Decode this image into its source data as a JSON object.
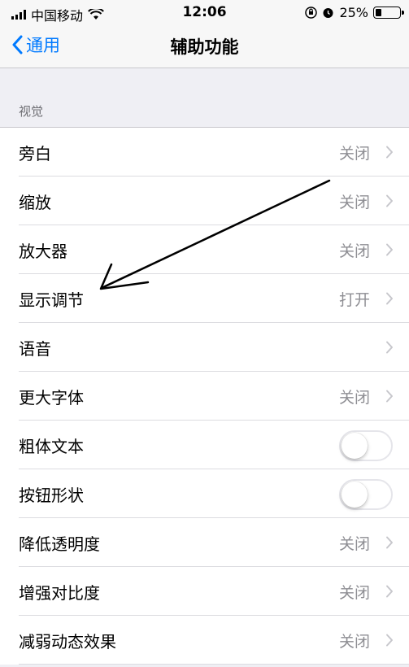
{
  "status_bar": {
    "carrier": "中国移动",
    "time": "12:06",
    "battery": "25%",
    "battery_level": 0.25,
    "icons": [
      "signal-icon",
      "wifi-icon",
      "orientation-lock-icon",
      "alarm-icon",
      "battery-icon"
    ]
  },
  "nav": {
    "back_label": "通用",
    "title": "辅助功能"
  },
  "section": {
    "header": "视觉"
  },
  "rows": [
    {
      "label": "旁白",
      "value": "关闭",
      "type": "detail"
    },
    {
      "label": "缩放",
      "value": "关闭",
      "type": "detail"
    },
    {
      "label": "放大器",
      "value": "关闭",
      "type": "detail"
    },
    {
      "label": "显示调节",
      "value": "打开",
      "type": "detail"
    },
    {
      "label": "语音",
      "value": "",
      "type": "detail"
    },
    {
      "label": "更大字体",
      "value": "关闭",
      "type": "detail"
    },
    {
      "label": "粗体文本",
      "value": "",
      "type": "toggle",
      "on": false
    },
    {
      "label": "按钮形状",
      "value": "",
      "type": "toggle",
      "on": false
    },
    {
      "label": "降低透明度",
      "value": "关闭",
      "type": "detail"
    },
    {
      "label": "增强对比度",
      "value": "关闭",
      "type": "detail"
    },
    {
      "label": "减弱动态效果",
      "value": "关闭",
      "type": "detail"
    }
  ],
  "colors": {
    "accent": "#007aff",
    "background": "#efeff4",
    "secondary_text": "#8e8e93"
  }
}
